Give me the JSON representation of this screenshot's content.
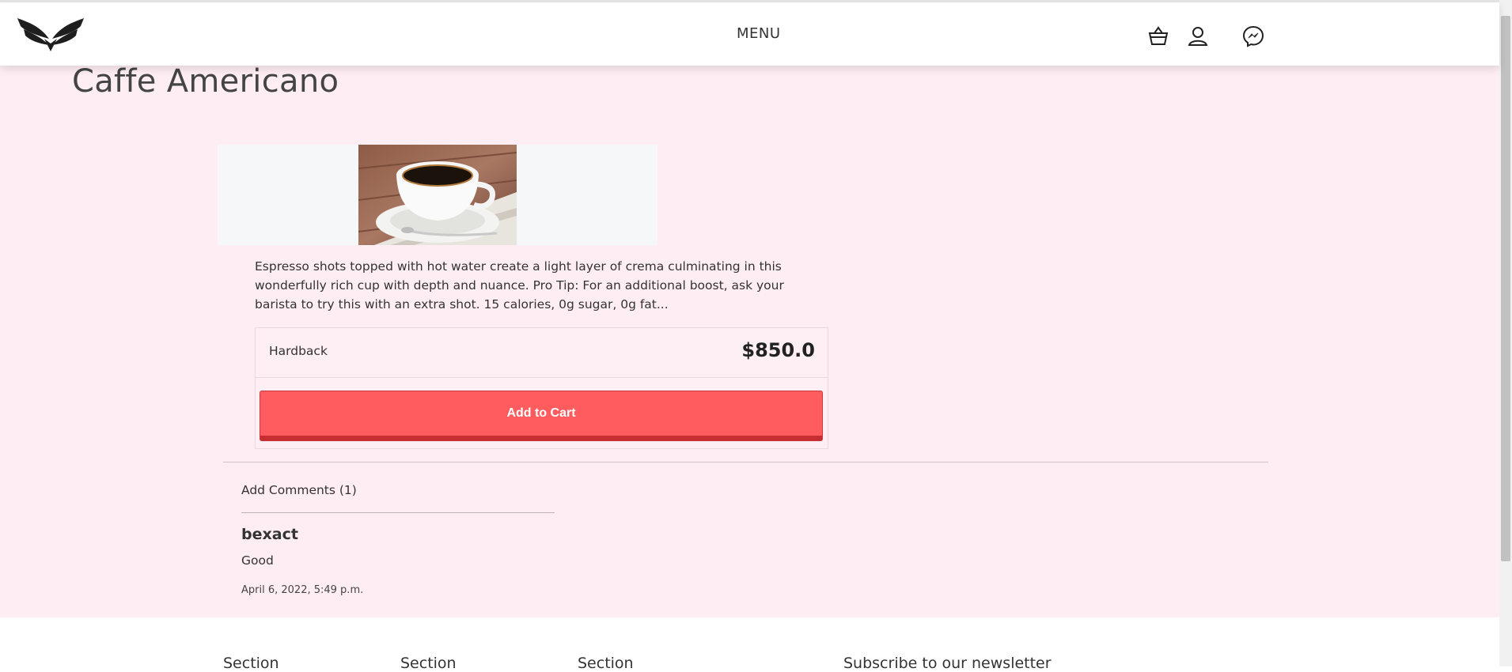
{
  "header": {
    "menu_label": "MENU",
    "icons": [
      "brand-wings-logo",
      "basket-icon",
      "user-icon",
      "messenger-icon"
    ]
  },
  "product": {
    "title": "Caffe Americano",
    "image_alt": "cup of coffee",
    "description": "Espresso shots topped with hot water create a light layer of crema culminating in this wonderfully rich cup with depth and nuance. Pro Tip: For an additional boost, ask your barista to try this with an extra shot. 15 calories, 0g sugar, 0g fat...",
    "format": "Hardback",
    "price": "$850.0",
    "add_to_cart_label": "Add to Cart"
  },
  "comments": {
    "toggle_label": "Add Comments (1)",
    "items": [
      {
        "author": "bexact",
        "text": "Good",
        "date": "April 6, 2022, 5:49 p.m."
      }
    ]
  },
  "footer": {
    "sections": [
      "Section",
      "Section",
      "Section"
    ],
    "newsletter_title": "Subscribe to our newsletter"
  },
  "colors": {
    "page_background": "#feeef3",
    "cart_button": "#ff5c5f",
    "cart_button_shadow": "#c62e31"
  }
}
